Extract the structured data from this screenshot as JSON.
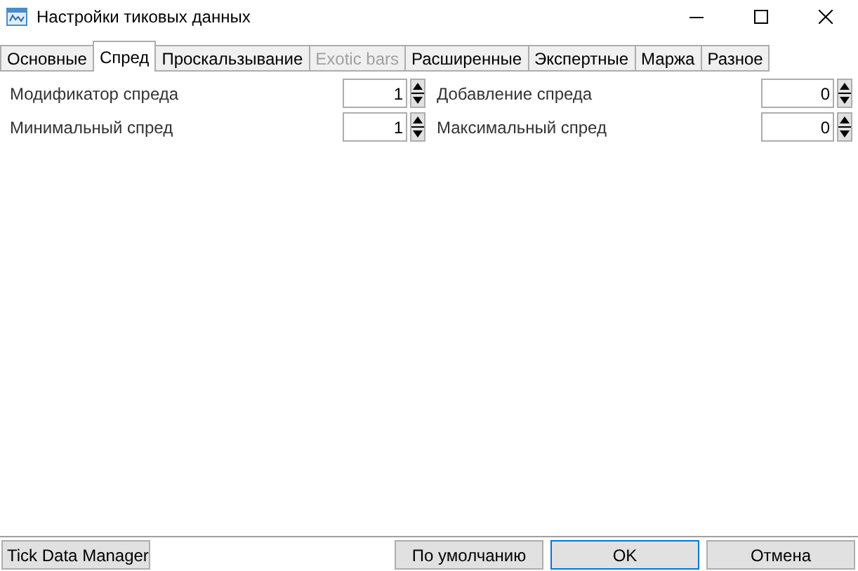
{
  "window": {
    "title": "Настройки тиковых данных"
  },
  "tabs": [
    {
      "label": "Основные",
      "selected": false,
      "disabled": false
    },
    {
      "label": "Спред",
      "selected": true,
      "disabled": false
    },
    {
      "label": "Проскальзывание",
      "selected": false,
      "disabled": false
    },
    {
      "label": "Exotic bars",
      "selected": false,
      "disabled": true
    },
    {
      "label": "Расширенные",
      "selected": false,
      "disabled": false
    },
    {
      "label": "Экспертные",
      "selected": false,
      "disabled": false
    },
    {
      "label": "Маржа",
      "selected": false,
      "disabled": false
    },
    {
      "label": "Разное",
      "selected": false,
      "disabled": false
    }
  ],
  "fields": [
    {
      "label": "Модификатор спреда",
      "value": "1"
    },
    {
      "label": "Добавление спреда",
      "value": "0"
    },
    {
      "label": "Минимальный спред",
      "value": "1"
    },
    {
      "label": "Максимальный спред",
      "value": "0"
    }
  ],
  "buttons": [
    {
      "label": "Tick Data Manager",
      "kind": "left",
      "default": false
    },
    {
      "label": "По умолчанию",
      "kind": "right",
      "default": false
    },
    {
      "label": "OK",
      "kind": "right",
      "default": true
    },
    {
      "label": "Отмена",
      "kind": "right",
      "default": false
    }
  ]
}
